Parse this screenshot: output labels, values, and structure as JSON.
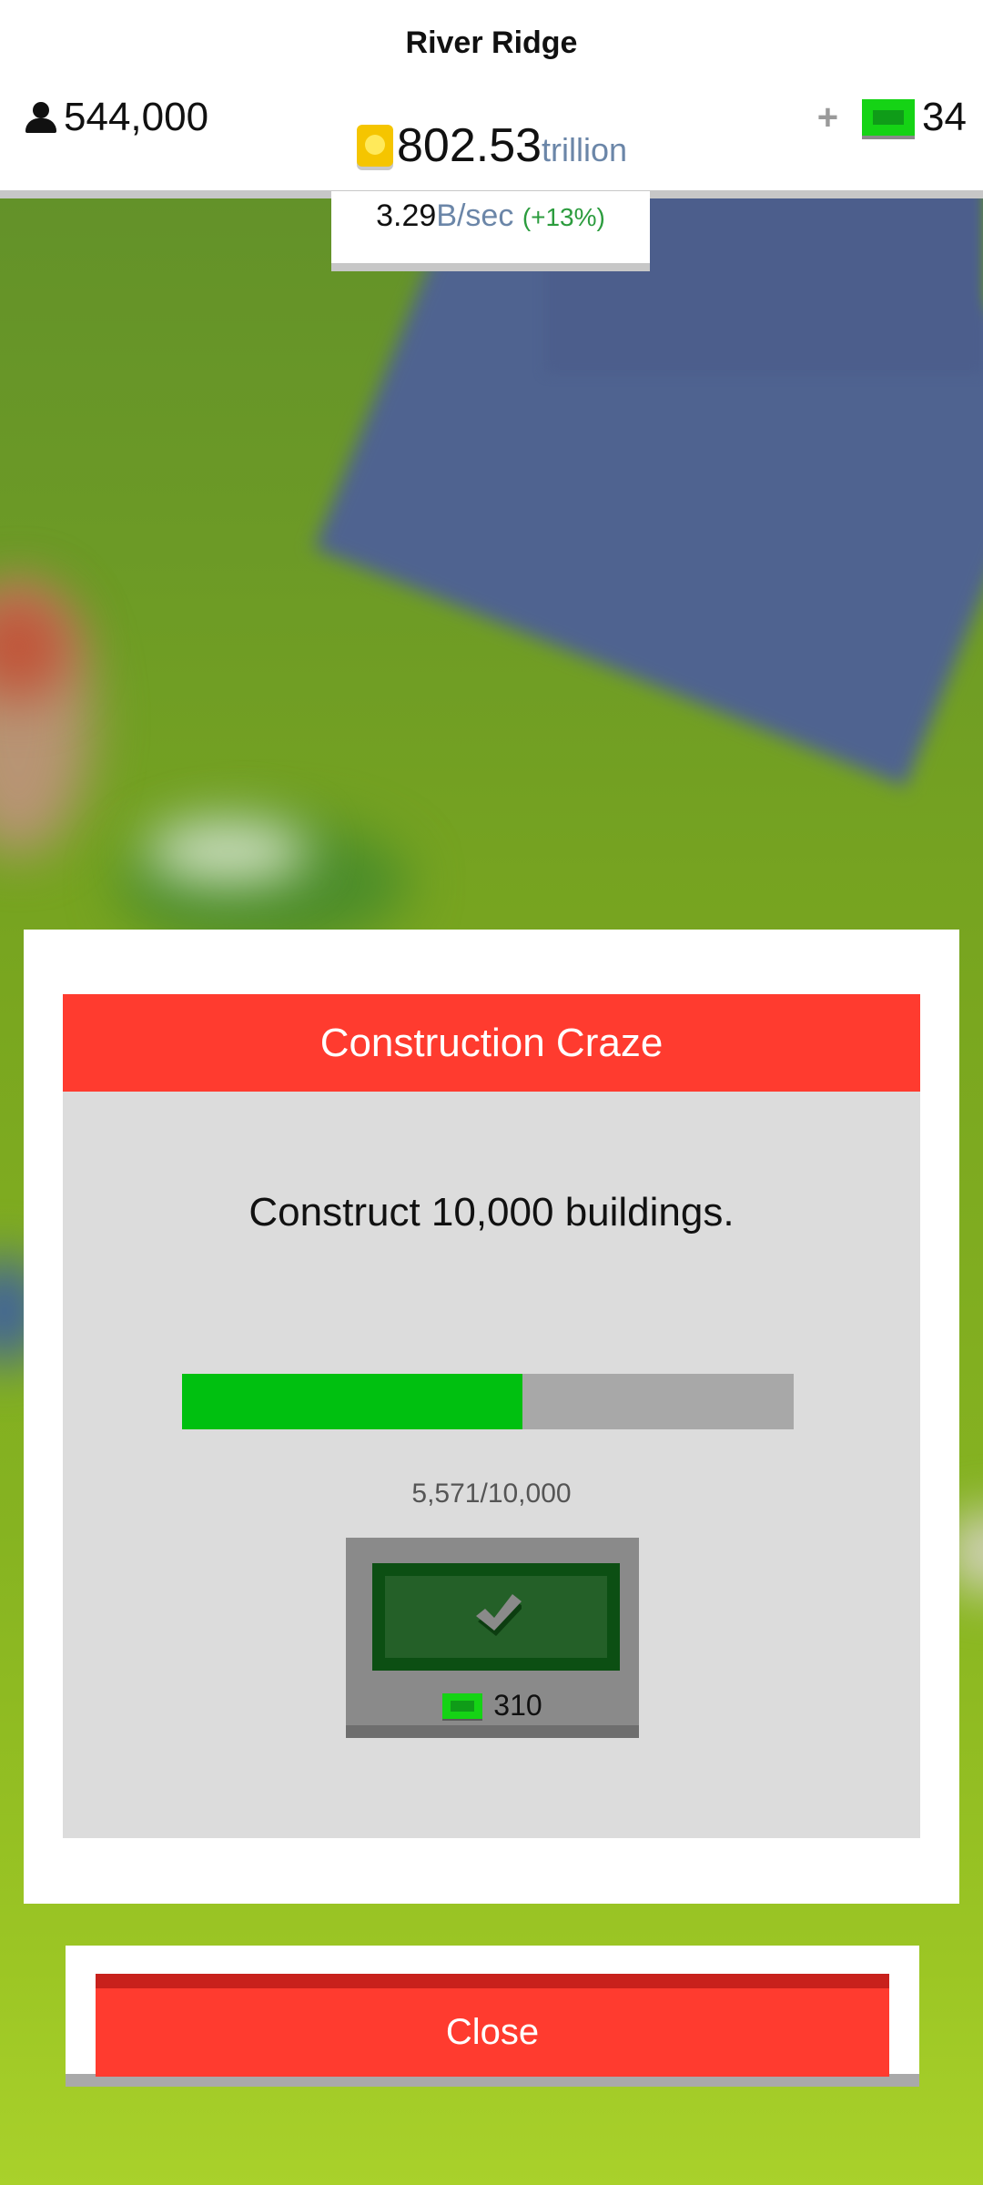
{
  "hud": {
    "city_name": "River Ridge",
    "population": "544,000",
    "money_value": "802.53",
    "money_unit": "trillion",
    "rate_value": "3.29",
    "rate_unit": "B/sec",
    "rate_bonus": "(+13%)",
    "gems": "34",
    "add_gems_label": "+"
  },
  "dialog": {
    "title": "Construction Craze",
    "description": "Construct 10,000 buildings.",
    "progress_text": "5,571/10,000",
    "progress_fraction": 0.5571,
    "reward_amount": "310"
  },
  "close_label": "Close",
  "colors": {
    "accent_red": "#ff3b2f",
    "progress_green": "#00c010",
    "gem_green": "#15d315",
    "coin_yellow": "#f5c500"
  },
  "icons": {
    "population": "person-icon",
    "currency": "coin-icon",
    "premium": "gem-icon",
    "claim": "check-icon"
  }
}
